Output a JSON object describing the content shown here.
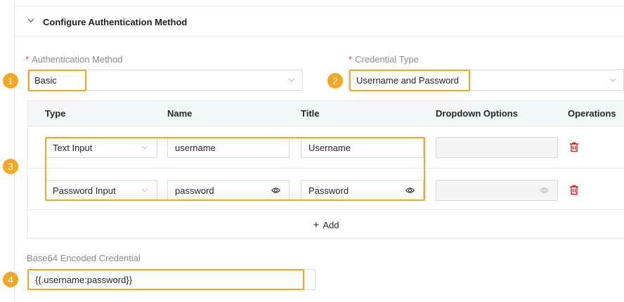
{
  "section": {
    "title": "Configure Authentication Method"
  },
  "auth_method": {
    "label": "Authentication Method",
    "required_mark": "*",
    "value": "Basic"
  },
  "credential_type": {
    "label": "Credential Type",
    "required_mark": "*",
    "value": "Username and Password"
  },
  "table": {
    "headers": {
      "type": "Type",
      "name": "Name",
      "title": "Title",
      "dropdown": "Dropdown Options",
      "operations": "Operations"
    },
    "rows": [
      {
        "type": "Text Input",
        "name": "username",
        "title": "Username",
        "dropdown": ""
      },
      {
        "type": "Password Input",
        "name": "password",
        "title": "Password",
        "dropdown": ""
      }
    ],
    "add_label": "Add"
  },
  "encoded": {
    "label": "Base64 Encoded Credential",
    "value": "{{.username:password}}"
  },
  "badges": [
    "1",
    "2",
    "3",
    "4"
  ],
  "colors": {
    "highlight": "#f5a623",
    "required": "#ff4d4f",
    "delete": "#e02020"
  }
}
